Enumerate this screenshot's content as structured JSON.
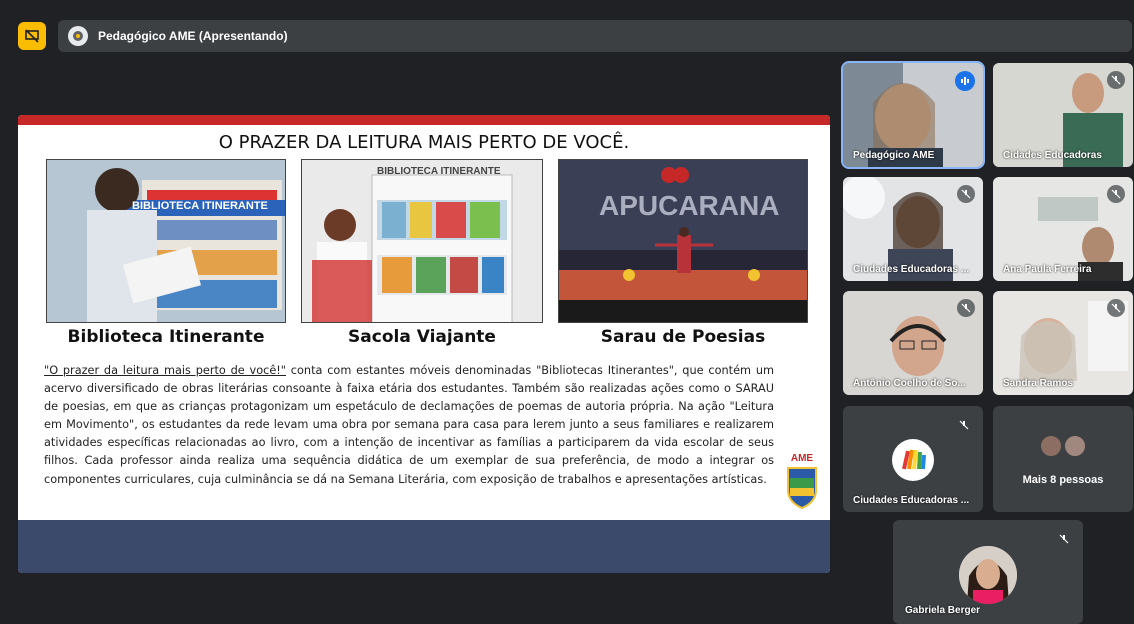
{
  "presentation": {
    "title": "Pedagógico AME (Apresentando)"
  },
  "slide": {
    "title": "O PRAZER DA LEITURA MAIS PERTO DE VOCÊ.",
    "captions": [
      "Biblioteca Itinerante",
      "Sacola Viajante",
      "Sarau de Poesias"
    ],
    "photo_texts": {
      "photo1_sign": "BIBLIOTECA ITINERANTE",
      "photo2_sign": "BIBLIOTECA ITINERANTE",
      "photo3_sign": "APUCARANA"
    },
    "body_quote": "\"O prazer da leitura mais perto de você!\"",
    "body_rest": " conta com estantes móveis denominadas \"Bibliotecas Itinerantes\", que contém um acervo diversificado de obras literárias consoante à faixa etária dos estudantes. Também são realizadas ações como o SARAU de poesias, em que as crianças protagonizam um espetáculo de declamações de poemas de autoria própria. Na ação \"Leitura em Movimento\", os estudantes da rede levam uma obra por semana para casa para lerem junto a seus familiares e realizarem atividades específicas relacionadas ao livro, com a intenção de incentivar as famílias a participarem da vida escolar de seus filhos. Cada professor ainda realiza uma sequência didática de um exemplar de sua preferência, de modo a integrar os componentes curriculares, cuja culminância se dá na Semana Literária, com exposição de trabalhos e apresentações artísticas.",
    "logo_text": "AME"
  },
  "participants": [
    {
      "name": "Pedagógico AME",
      "status": "speaking"
    },
    {
      "name": "Cidades Educadoras",
      "status": "muted"
    },
    {
      "name": "Ciudades Educadoras ...",
      "status": "muted"
    },
    {
      "name": "Ana Paula Ferreira",
      "status": "muted"
    },
    {
      "name": "Antônio Coelho de So...",
      "status": "muted"
    },
    {
      "name": "Sandra Ramos",
      "status": "muted"
    },
    {
      "name": "Ciudades Educadoras ...",
      "status": "muted"
    },
    {
      "name": "Mais 8 pessoas",
      "status": ""
    },
    {
      "name": "Gabriela Berger",
      "status": "muted"
    }
  ],
  "colors": {
    "background": "#202124",
    "tile": "#3c4043",
    "accent_red": "#c62828",
    "present_icon": "#fbbc04",
    "speaking": "#1a73e8"
  }
}
